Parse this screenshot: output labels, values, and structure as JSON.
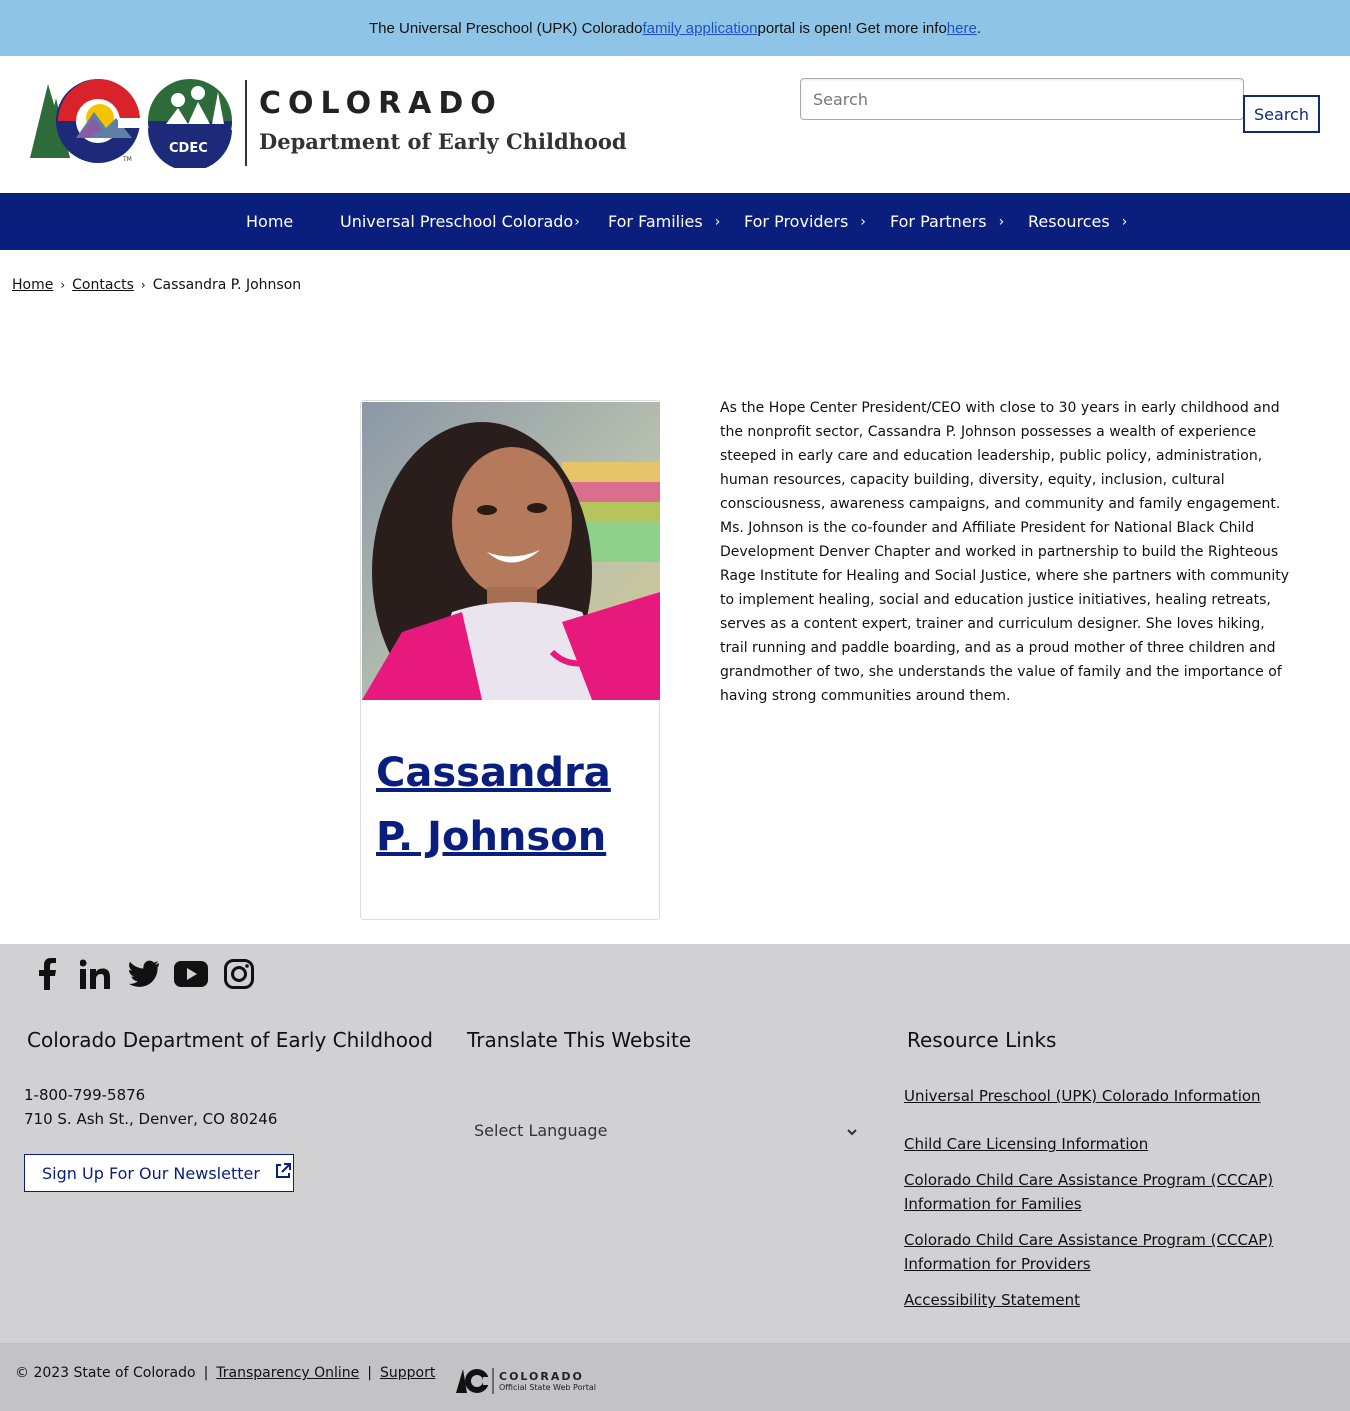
{
  "alert": {
    "text_before": "The Universal Preschool (UPK) Colorado ",
    "link1": "family application",
    "text_middle": " portal is open! Get more info ",
    "link2": "here",
    "text_after": "."
  },
  "header": {
    "brand_title": "COLORADO",
    "brand_subtitle": "Department of Early Childhood",
    "logo_badge": "CDEC",
    "search_placeholder": "Search",
    "search_button": "Search"
  },
  "nav": {
    "items": [
      {
        "label": "Home",
        "has_submenu": false
      },
      {
        "label": "Universal Preschool Colorado",
        "has_submenu": true
      },
      {
        "label": "For Families",
        "has_submenu": true
      },
      {
        "label": "For Providers",
        "has_submenu": true
      },
      {
        "label": "For Partners",
        "has_submenu": true
      },
      {
        "label": "Resources",
        "has_submenu": true
      }
    ]
  },
  "breadcrumb": {
    "items": [
      "Home",
      "Contacts",
      "Cassandra P. Johnson"
    ]
  },
  "profile": {
    "name": "Cassandra P. Johnson",
    "bio": "As the Hope Center President/CEO with close to 30 years in early childhood and the nonprofit sector, Cassandra P. Johnson possesses a wealth of experience steeped in early care and education leadership, public policy, administration, human resources, capacity building, diversity, equity, inclusion, cultural consciousness, awareness campaigns, and community and family engagement. Ms. Johnson is the co-founder and Affiliate President for National Black Child Development Denver Chapter and worked in partnership to build the Righteous Rage Institute for Healing and Social Justice, where she partners with community to implement healing, social and education justice initiatives, healing retreats, serves as a content expert, trainer and curriculum designer. She loves hiking, trail running and paddle boarding, and as a proud mother of three children and grandmother of two, she understands the value of family and the importance of having strong communities around them."
  },
  "footer": {
    "social": [
      "facebook-icon",
      "linkedin-icon",
      "twitter-icon",
      "youtube-icon",
      "instagram-icon"
    ],
    "org_title": "Colorado Department of Early Childhood",
    "phone": "1-800-799-5876",
    "address": "710 S. Ash St., Denver, CO 80246",
    "newsletter": "Sign Up For Our Newsletter",
    "translate_title": "Translate This Website",
    "language_select": "Select Language",
    "resources_title": "Resource Links",
    "resource_links": [
      "Universal Preschool (UPK) Colorado Information",
      "Child Care Licensing Information",
      "Colorado Child Care Assistance Program (CCCAP) Information for Families",
      "Colorado Child Care Assistance Program (CCCAP) Information for Providers",
      "Accessibility Statement"
    ],
    "copyright": "© 2023 State of Colorado",
    "separator": "|",
    "transparency": "Transparency Online",
    "support": "Support",
    "portal_title": "COLORADO",
    "portal_subtitle": "Official State Web Portal"
  },
  "colors": {
    "alert_bg": "#8ec5e6",
    "nav_bg": "#0a1f7d",
    "footer_bg": "#d1d1d3",
    "link_blue": "#1e50c8"
  }
}
